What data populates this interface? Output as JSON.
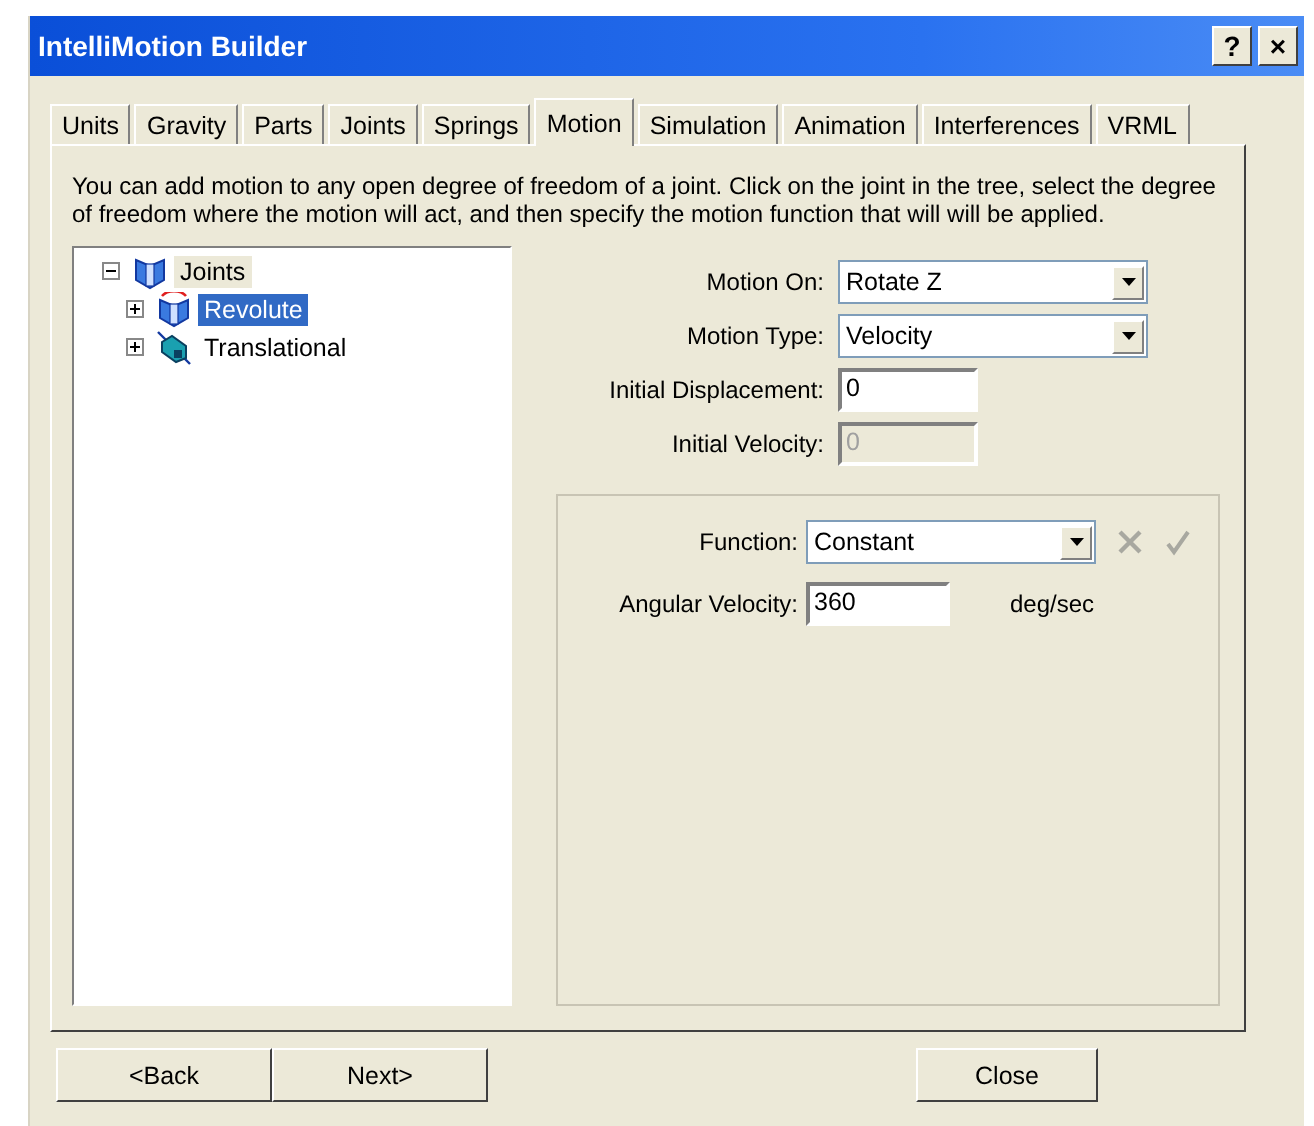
{
  "window": {
    "title": "IntelliMotion Builder",
    "help": "?",
    "close": "×"
  },
  "tabs": [
    {
      "label": "Units",
      "selected": false
    },
    {
      "label": "Gravity",
      "selected": false
    },
    {
      "label": "Parts",
      "selected": false
    },
    {
      "label": "Joints",
      "selected": false
    },
    {
      "label": "Springs",
      "selected": false
    },
    {
      "label": "Motion",
      "selected": true
    },
    {
      "label": "Simulation",
      "selected": false
    },
    {
      "label": "Animation",
      "selected": false
    },
    {
      "label": "Interferences",
      "selected": false
    },
    {
      "label": "VRML",
      "selected": false
    }
  ],
  "description": "You can add motion to any open degree of freedom of a joint. Click on the joint in the tree, select the degree of freedom where the motion will act, and then specify the motion function that will will be applied.",
  "tree": {
    "label": "Joints",
    "expanded": true,
    "children": [
      {
        "label": "Revolute",
        "kind": "revolute",
        "selected": true,
        "expanded": false
      },
      {
        "label": "Translational",
        "kind": "translational",
        "selected": false,
        "expanded": false
      }
    ]
  },
  "fields": [
    {
      "label": "Motion On:",
      "kind": "dropdown",
      "value": "Rotate Z",
      "disabled": false
    },
    {
      "label": "Motion Type:",
      "kind": "dropdown",
      "value": "Velocity",
      "disabled": false
    },
    {
      "label": "Initial Displacement:",
      "kind": "text",
      "value": "0",
      "disabled": false
    },
    {
      "label": "Initial Velocity:",
      "kind": "text",
      "value": "0",
      "disabled": true
    }
  ],
  "function_group": {
    "function_label": "Function:",
    "function_value": "Constant",
    "param_label": "Angular Velocity:",
    "param_value": "360",
    "param_unit": "deg/sec"
  },
  "buttons": [
    {
      "label": "<Back",
      "kind": "nav"
    },
    {
      "label": "Next>",
      "kind": "nav"
    },
    {
      "label": "Close",
      "kind": "close"
    }
  ]
}
